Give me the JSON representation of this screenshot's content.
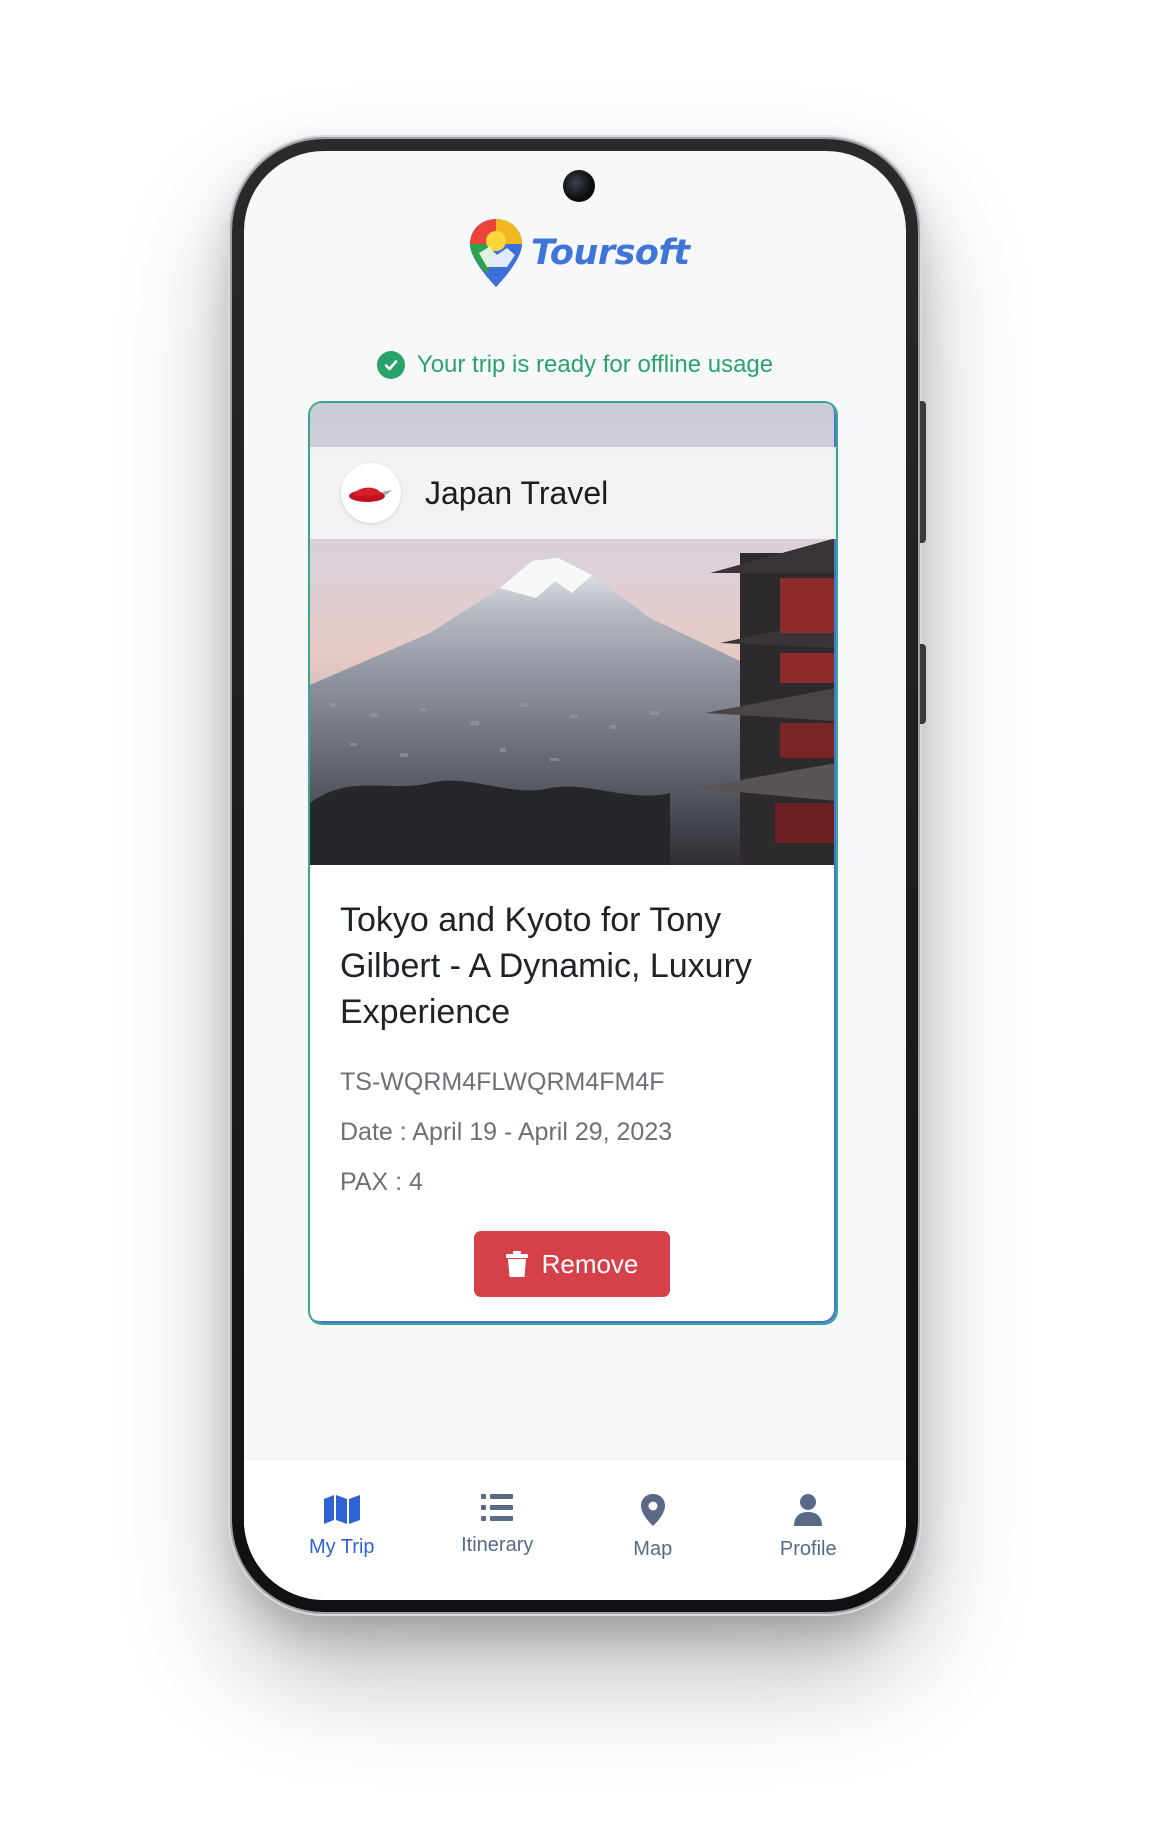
{
  "header": {
    "brand_name": "Toursoft",
    "logo_icon": "map-pin-logo"
  },
  "status": {
    "offline_message": "Your trip is ready for offline usage",
    "icon": "check-circle-icon",
    "color": "#2aa36a"
  },
  "trip_card": {
    "agency_name": "Japan Travel",
    "agency_logo_icon": "red-hat-logo",
    "hero_image": "mount-fuji-pagoda-photo",
    "title": "Tokyo and Kyoto for Tony Gilbert - A Dynamic, Luxury Experience",
    "booking_code": "TS-WQRM4FLWQRM4FM4F",
    "date": "Date : April 19 - April 29, 2023",
    "pax": "PAX : 4",
    "remove_label": "Remove",
    "remove_color": "#d54148"
  },
  "bottom_nav": {
    "items": [
      {
        "label": "My Trip",
        "icon": "map-icon",
        "active": true
      },
      {
        "label": "Itinerary",
        "icon": "list-icon",
        "active": false
      },
      {
        "label": "Map",
        "icon": "location-pin-icon",
        "active": false
      },
      {
        "label": "Profile",
        "icon": "user-icon",
        "active": false
      }
    ],
    "active_color": "#2f63d3",
    "inactive_color": "#5a6a86"
  }
}
